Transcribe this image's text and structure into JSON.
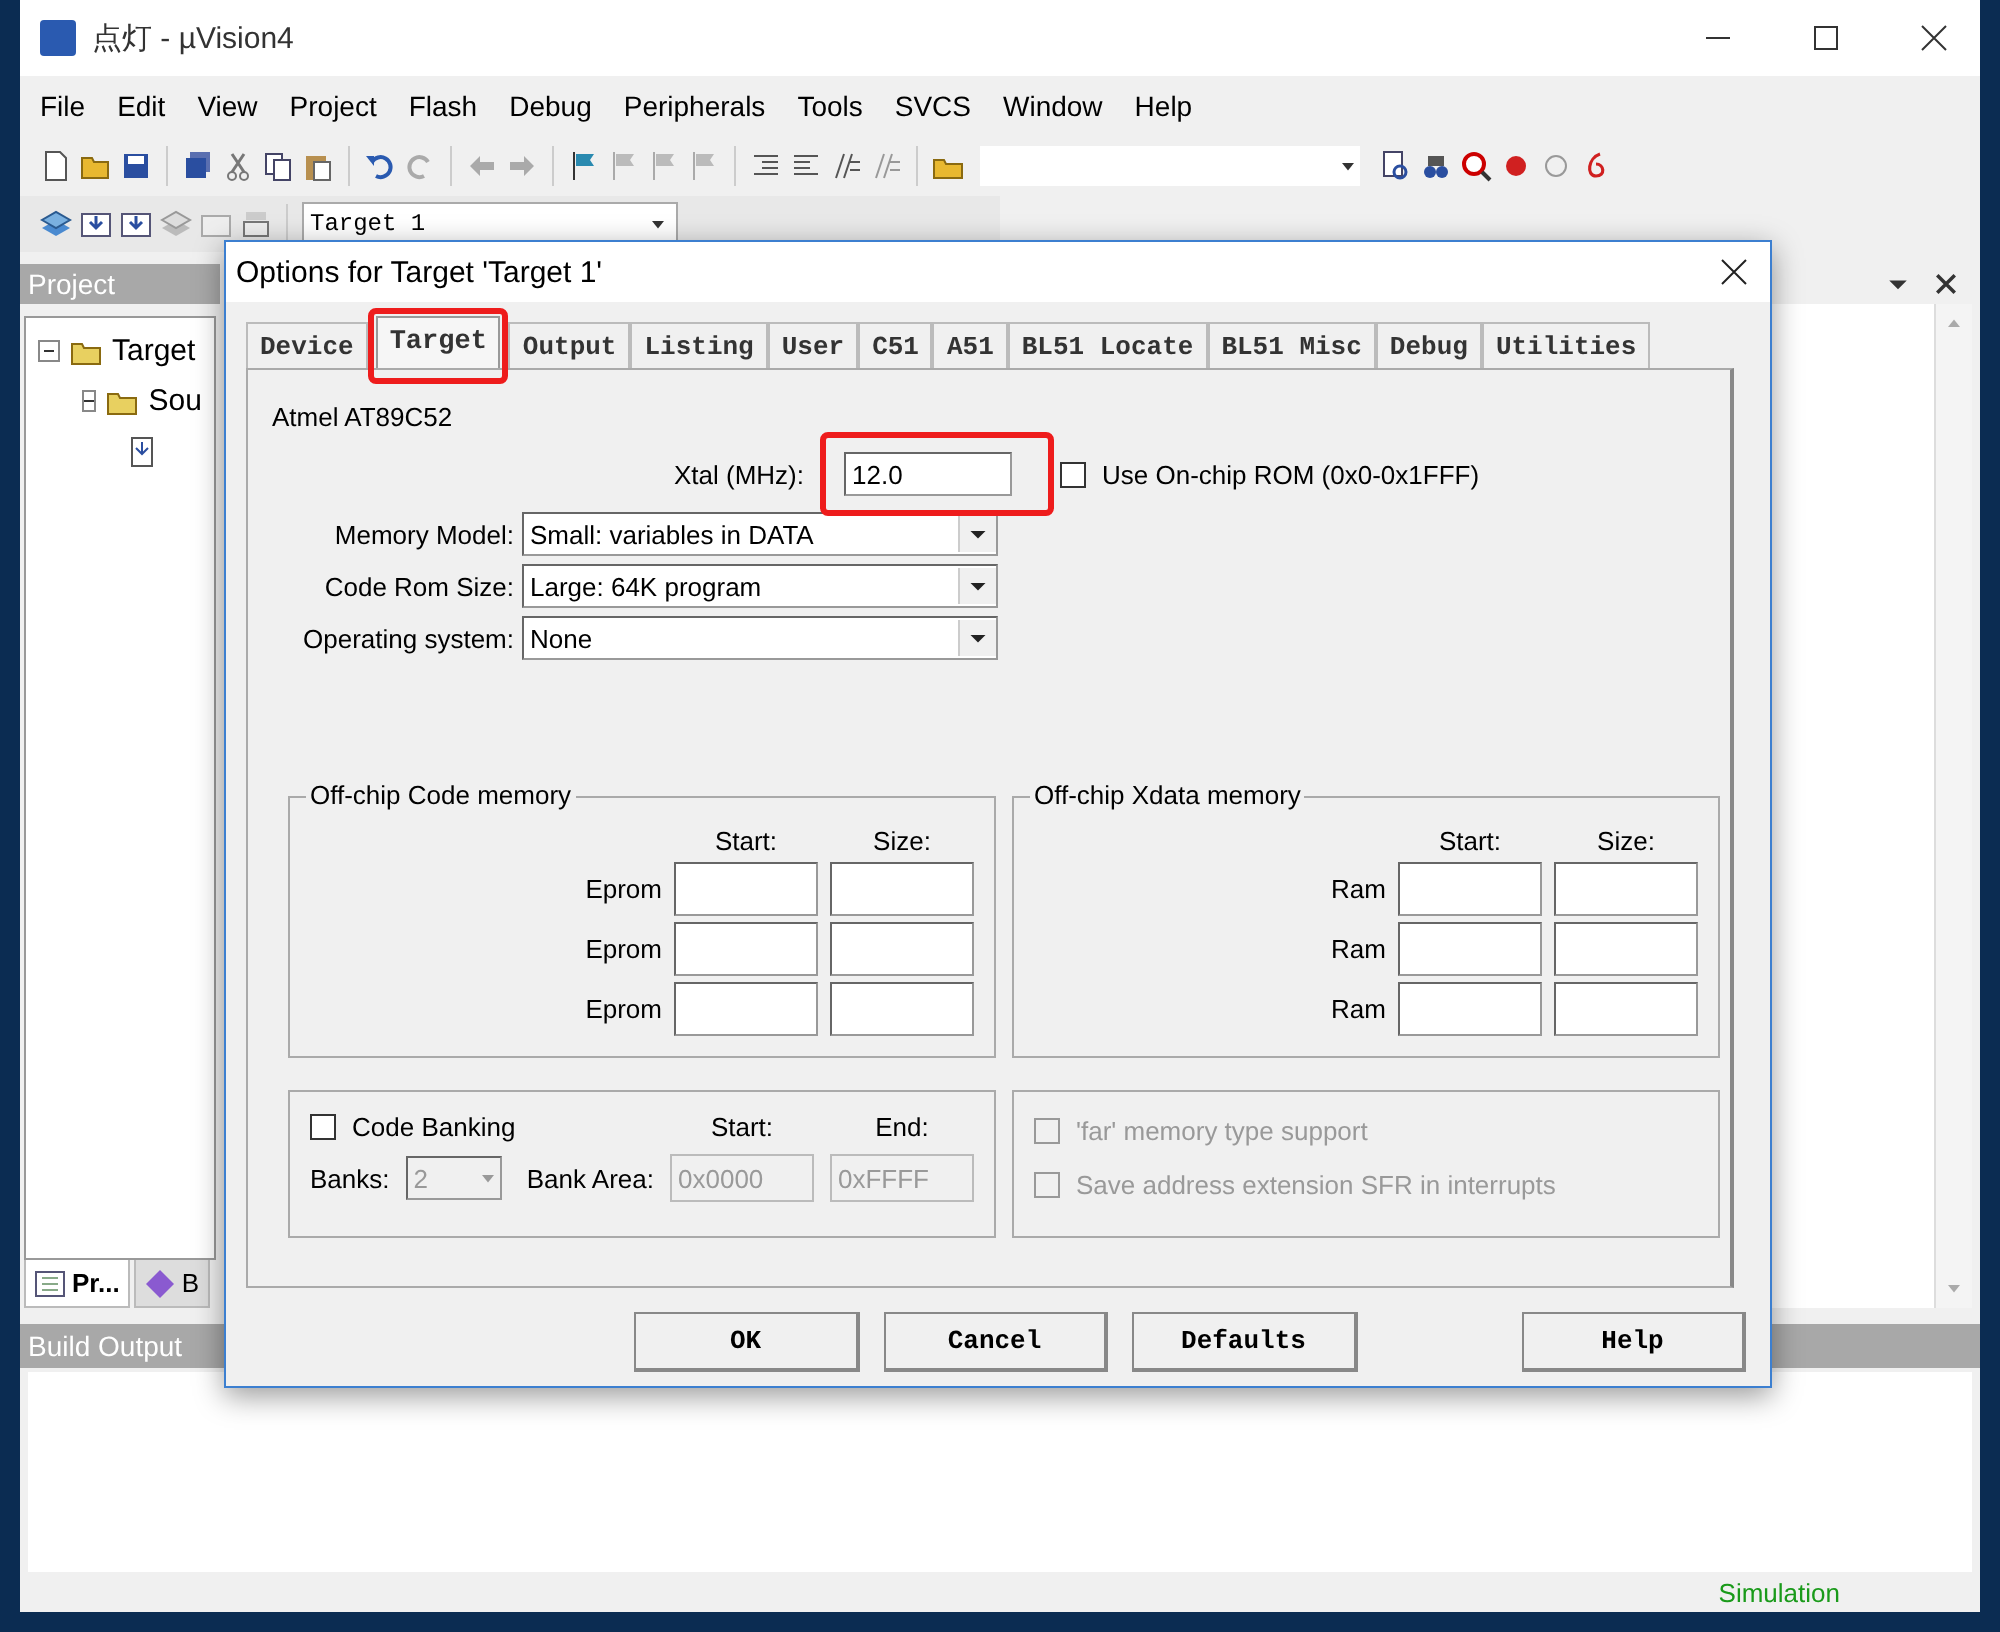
{
  "window": {
    "title": "点灯 - µVision4"
  },
  "menu": [
    "File",
    "Edit",
    "View",
    "Project",
    "Flash",
    "Debug",
    "Peripherals",
    "Tools",
    "SVCS",
    "Window",
    "Help"
  ],
  "target_combo": "Target 1",
  "project_panel": {
    "title": "Project",
    "tree": [
      {
        "label": "Target",
        "expanded": true,
        "children": [
          {
            "label": "Sou",
            "expanded": true,
            "children": [
              {
                "kind": "file"
              }
            ]
          }
        ]
      }
    ],
    "tabs": [
      {
        "label": "Pr...",
        "selected": true
      },
      {
        "label": "B",
        "selected": false
      }
    ]
  },
  "build_output": {
    "title": "Build Output"
  },
  "status_bar": {
    "mode": "Simulation"
  },
  "dialog": {
    "title": "Options for Target 'Target 1'",
    "tabs": [
      {
        "label": "Device",
        "selected": false,
        "highlighted": false
      },
      {
        "label": "Target",
        "selected": true,
        "highlighted": true
      },
      {
        "label": "Output",
        "selected": false,
        "highlighted": false
      },
      {
        "label": "Listing",
        "selected": false,
        "highlighted": false
      },
      {
        "label": "User",
        "selected": false,
        "highlighted": false
      },
      {
        "label": "C51",
        "selected": false,
        "highlighted": false
      },
      {
        "label": "A51",
        "selected": false,
        "highlighted": false
      },
      {
        "label": "BL51 Locate",
        "selected": false,
        "highlighted": false
      },
      {
        "label": "BL51 Misc",
        "selected": false,
        "highlighted": false
      },
      {
        "label": "Debug",
        "selected": false,
        "highlighted": false
      },
      {
        "label": "Utilities",
        "selected": false,
        "highlighted": false
      }
    ],
    "device": "Atmel AT89C52",
    "xtal": {
      "label": "Xtal (MHz):",
      "value": "12.0",
      "highlighted": true
    },
    "on_chip_rom": {
      "label": "Use On-chip ROM (0x0-0x1FFF)",
      "checked": false
    },
    "selects": [
      {
        "label": "Memory Model:",
        "value": "Small: variables in DATA"
      },
      {
        "label": "Code Rom Size:",
        "value": "Large: 64K program"
      },
      {
        "label": "Operating system:",
        "value": "None"
      }
    ],
    "code_memory": {
      "title": "Off-chip Code memory",
      "columns": [
        "Start:",
        "Size:"
      ],
      "rows": [
        "Eprom",
        "Eprom",
        "Eprom"
      ]
    },
    "xdata_memory": {
      "title": "Off-chip Xdata memory",
      "columns": [
        "Start:",
        "Size:"
      ],
      "rows": [
        "Ram",
        "Ram",
        "Ram"
      ]
    },
    "banking": {
      "label": "Code Banking",
      "checked": false,
      "banks_label": "Banks:",
      "banks": "2",
      "start_label": "Start:",
      "end_label": "End:",
      "area_label": "Bank Area:",
      "start": "0x0000",
      "end": "0xFFFF"
    },
    "options": [
      {
        "label": "'far' memory type support",
        "checked": false,
        "disabled": true
      },
      {
        "label": "Save address extension SFR in interrupts",
        "checked": false,
        "disabled": true
      }
    ],
    "buttons": [
      "OK",
      "Cancel",
      "Defaults",
      "Help"
    ]
  }
}
